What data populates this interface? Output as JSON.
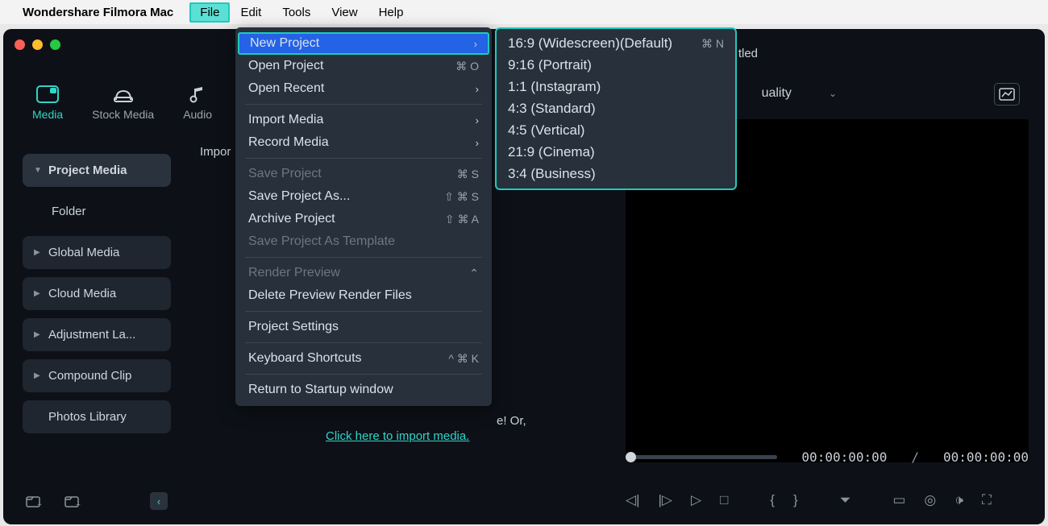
{
  "menubar": {
    "app": "Wondershare Filmora Mac",
    "items": [
      "File",
      "Edit",
      "Tools",
      "View",
      "Help"
    ],
    "active": "File"
  },
  "window": {
    "title": "tled"
  },
  "tabs": [
    {
      "label": "Media",
      "active": true
    },
    {
      "label": "Stock Media"
    },
    {
      "label": "Audio"
    }
  ],
  "sidebar": {
    "items": [
      {
        "label": "Project Media",
        "kind": "hl",
        "caret": "down"
      },
      {
        "label": "Folder",
        "kind": "indent"
      },
      {
        "label": "Global Media",
        "caret": "right"
      },
      {
        "label": "Cloud Media",
        "caret": "right"
      },
      {
        "label": "Adjustment La...",
        "caret": "right"
      },
      {
        "label": "Compound Clip",
        "caret": "right"
      },
      {
        "label": "Photos Library"
      }
    ]
  },
  "content": {
    "import_label": "Impor"
  },
  "import_hint": {
    "tail": "e! Or,",
    "link": "Click here to import media."
  },
  "quality": {
    "label": "uality"
  },
  "player": {
    "current": "00:00:00:00",
    "sep": "/",
    "total": "00:00:00:00"
  },
  "file_menu": {
    "rows": [
      {
        "label": "New Project",
        "sub": true,
        "sel": true
      },
      {
        "label": "Open Project",
        "shortcut": "⌘ O"
      },
      {
        "label": "Open Recent",
        "sub": true
      },
      {
        "sep": true
      },
      {
        "label": "Import Media",
        "sub": true
      },
      {
        "label": "Record Media",
        "sub": true
      },
      {
        "sep": true
      },
      {
        "label": "Save Project",
        "shortcut": "⌘ S",
        "disabled": true
      },
      {
        "label": "Save Project As...",
        "shortcut": "⇧ ⌘ S"
      },
      {
        "label": "Archive Project",
        "shortcut": "⇧ ⌘ A"
      },
      {
        "label": "Save Project As Template",
        "disabled": true
      },
      {
        "sep": true
      },
      {
        "label": "Render Preview",
        "disabled": true,
        "collapse": true
      },
      {
        "label": "Delete Preview Render Files"
      },
      {
        "sep": true
      },
      {
        "label": "Project Settings"
      },
      {
        "sep": true
      },
      {
        "label": "Keyboard Shortcuts",
        "shortcut": "^ ⌘ K"
      },
      {
        "sep": true
      },
      {
        "label": "Return to Startup window"
      }
    ]
  },
  "new_project_submenu": [
    {
      "label": "16:9 (Widescreen)(Default)",
      "shortcut": "⌘ N"
    },
    {
      "label": "9:16 (Portrait)"
    },
    {
      "label": "1:1 (Instagram)"
    },
    {
      "label": "4:3 (Standard)"
    },
    {
      "label": "4:5 (Vertical)"
    },
    {
      "label": "21:9 (Cinema)"
    },
    {
      "label": "3:4 (Business)"
    }
  ]
}
